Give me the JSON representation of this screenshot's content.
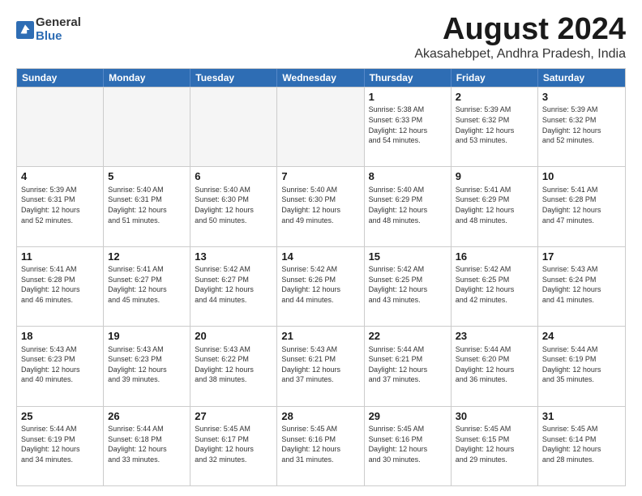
{
  "header": {
    "logo_general": "General",
    "logo_blue": "Blue",
    "main_title": "August 2024",
    "subtitle": "Akasahebpet, Andhra Pradesh, India"
  },
  "weekdays": [
    "Sunday",
    "Monday",
    "Tuesday",
    "Wednesday",
    "Thursday",
    "Friday",
    "Saturday"
  ],
  "rows": [
    [
      {
        "day": "",
        "info": ""
      },
      {
        "day": "",
        "info": ""
      },
      {
        "day": "",
        "info": ""
      },
      {
        "day": "",
        "info": ""
      },
      {
        "day": "1",
        "info": "Sunrise: 5:38 AM\nSunset: 6:33 PM\nDaylight: 12 hours\nand 54 minutes."
      },
      {
        "day": "2",
        "info": "Sunrise: 5:39 AM\nSunset: 6:32 PM\nDaylight: 12 hours\nand 53 minutes."
      },
      {
        "day": "3",
        "info": "Sunrise: 5:39 AM\nSunset: 6:32 PM\nDaylight: 12 hours\nand 52 minutes."
      }
    ],
    [
      {
        "day": "4",
        "info": "Sunrise: 5:39 AM\nSunset: 6:31 PM\nDaylight: 12 hours\nand 52 minutes."
      },
      {
        "day": "5",
        "info": "Sunrise: 5:40 AM\nSunset: 6:31 PM\nDaylight: 12 hours\nand 51 minutes."
      },
      {
        "day": "6",
        "info": "Sunrise: 5:40 AM\nSunset: 6:30 PM\nDaylight: 12 hours\nand 50 minutes."
      },
      {
        "day": "7",
        "info": "Sunrise: 5:40 AM\nSunset: 6:30 PM\nDaylight: 12 hours\nand 49 minutes."
      },
      {
        "day": "8",
        "info": "Sunrise: 5:40 AM\nSunset: 6:29 PM\nDaylight: 12 hours\nand 48 minutes."
      },
      {
        "day": "9",
        "info": "Sunrise: 5:41 AM\nSunset: 6:29 PM\nDaylight: 12 hours\nand 48 minutes."
      },
      {
        "day": "10",
        "info": "Sunrise: 5:41 AM\nSunset: 6:28 PM\nDaylight: 12 hours\nand 47 minutes."
      }
    ],
    [
      {
        "day": "11",
        "info": "Sunrise: 5:41 AM\nSunset: 6:28 PM\nDaylight: 12 hours\nand 46 minutes."
      },
      {
        "day": "12",
        "info": "Sunrise: 5:41 AM\nSunset: 6:27 PM\nDaylight: 12 hours\nand 45 minutes."
      },
      {
        "day": "13",
        "info": "Sunrise: 5:42 AM\nSunset: 6:27 PM\nDaylight: 12 hours\nand 44 minutes."
      },
      {
        "day": "14",
        "info": "Sunrise: 5:42 AM\nSunset: 6:26 PM\nDaylight: 12 hours\nand 44 minutes."
      },
      {
        "day": "15",
        "info": "Sunrise: 5:42 AM\nSunset: 6:25 PM\nDaylight: 12 hours\nand 43 minutes."
      },
      {
        "day": "16",
        "info": "Sunrise: 5:42 AM\nSunset: 6:25 PM\nDaylight: 12 hours\nand 42 minutes."
      },
      {
        "day": "17",
        "info": "Sunrise: 5:43 AM\nSunset: 6:24 PM\nDaylight: 12 hours\nand 41 minutes."
      }
    ],
    [
      {
        "day": "18",
        "info": "Sunrise: 5:43 AM\nSunset: 6:23 PM\nDaylight: 12 hours\nand 40 minutes."
      },
      {
        "day": "19",
        "info": "Sunrise: 5:43 AM\nSunset: 6:23 PM\nDaylight: 12 hours\nand 39 minutes."
      },
      {
        "day": "20",
        "info": "Sunrise: 5:43 AM\nSunset: 6:22 PM\nDaylight: 12 hours\nand 38 minutes."
      },
      {
        "day": "21",
        "info": "Sunrise: 5:43 AM\nSunset: 6:21 PM\nDaylight: 12 hours\nand 37 minutes."
      },
      {
        "day": "22",
        "info": "Sunrise: 5:44 AM\nSunset: 6:21 PM\nDaylight: 12 hours\nand 37 minutes."
      },
      {
        "day": "23",
        "info": "Sunrise: 5:44 AM\nSunset: 6:20 PM\nDaylight: 12 hours\nand 36 minutes."
      },
      {
        "day": "24",
        "info": "Sunrise: 5:44 AM\nSunset: 6:19 PM\nDaylight: 12 hours\nand 35 minutes."
      }
    ],
    [
      {
        "day": "25",
        "info": "Sunrise: 5:44 AM\nSunset: 6:19 PM\nDaylight: 12 hours\nand 34 minutes."
      },
      {
        "day": "26",
        "info": "Sunrise: 5:44 AM\nSunset: 6:18 PM\nDaylight: 12 hours\nand 33 minutes."
      },
      {
        "day": "27",
        "info": "Sunrise: 5:45 AM\nSunset: 6:17 PM\nDaylight: 12 hours\nand 32 minutes."
      },
      {
        "day": "28",
        "info": "Sunrise: 5:45 AM\nSunset: 6:16 PM\nDaylight: 12 hours\nand 31 minutes."
      },
      {
        "day": "29",
        "info": "Sunrise: 5:45 AM\nSunset: 6:16 PM\nDaylight: 12 hours\nand 30 minutes."
      },
      {
        "day": "30",
        "info": "Sunrise: 5:45 AM\nSunset: 6:15 PM\nDaylight: 12 hours\nand 29 minutes."
      },
      {
        "day": "31",
        "info": "Sunrise: 5:45 AM\nSunset: 6:14 PM\nDaylight: 12 hours\nand 28 minutes."
      }
    ]
  ]
}
